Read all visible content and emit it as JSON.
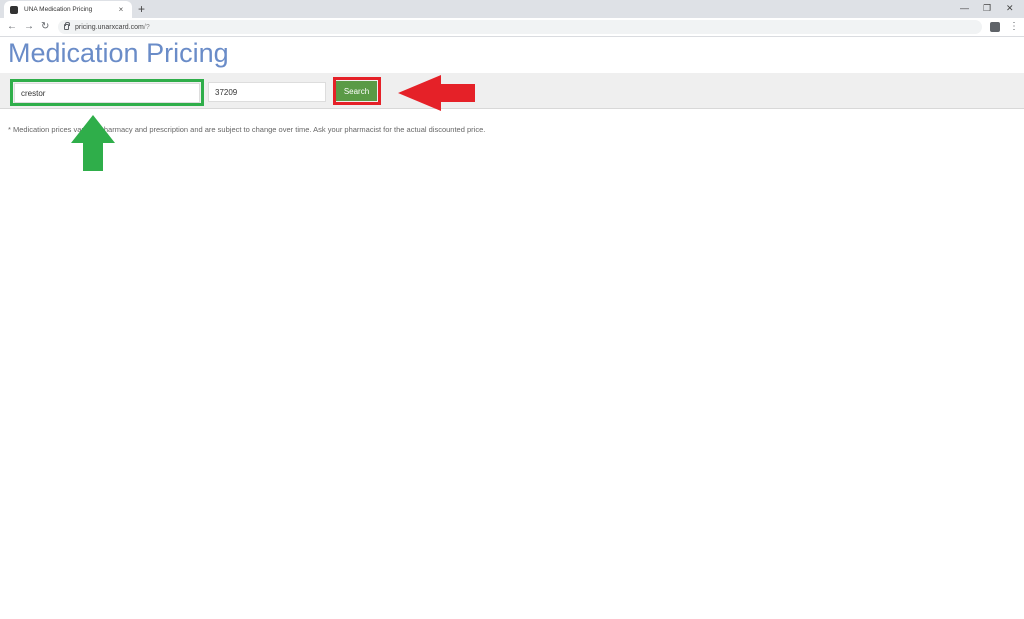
{
  "browser": {
    "tab_title": "UNA Medication Pricing",
    "tab_close": "×",
    "new_tab": "+",
    "url_host": "pricing.unarxcard.com",
    "url_path": "/?",
    "back_icon": "←",
    "forward_icon": "→",
    "reload_icon": "↻",
    "minimize_icon": "—",
    "restore_icon": "❐",
    "close_icon": "✕",
    "menu_icon": "⋮"
  },
  "page": {
    "title": "Medication Pricing",
    "drug_value": "crestor",
    "zip_value": "37209",
    "search_label": "Search",
    "disclaimer": "* Medication prices vary by pharmacy and prescription and are subject to change over time. Ask your pharmacist for the actual discounted price."
  },
  "annotations": {
    "green_color": "#2fae4a",
    "red_color": "#e52128"
  }
}
